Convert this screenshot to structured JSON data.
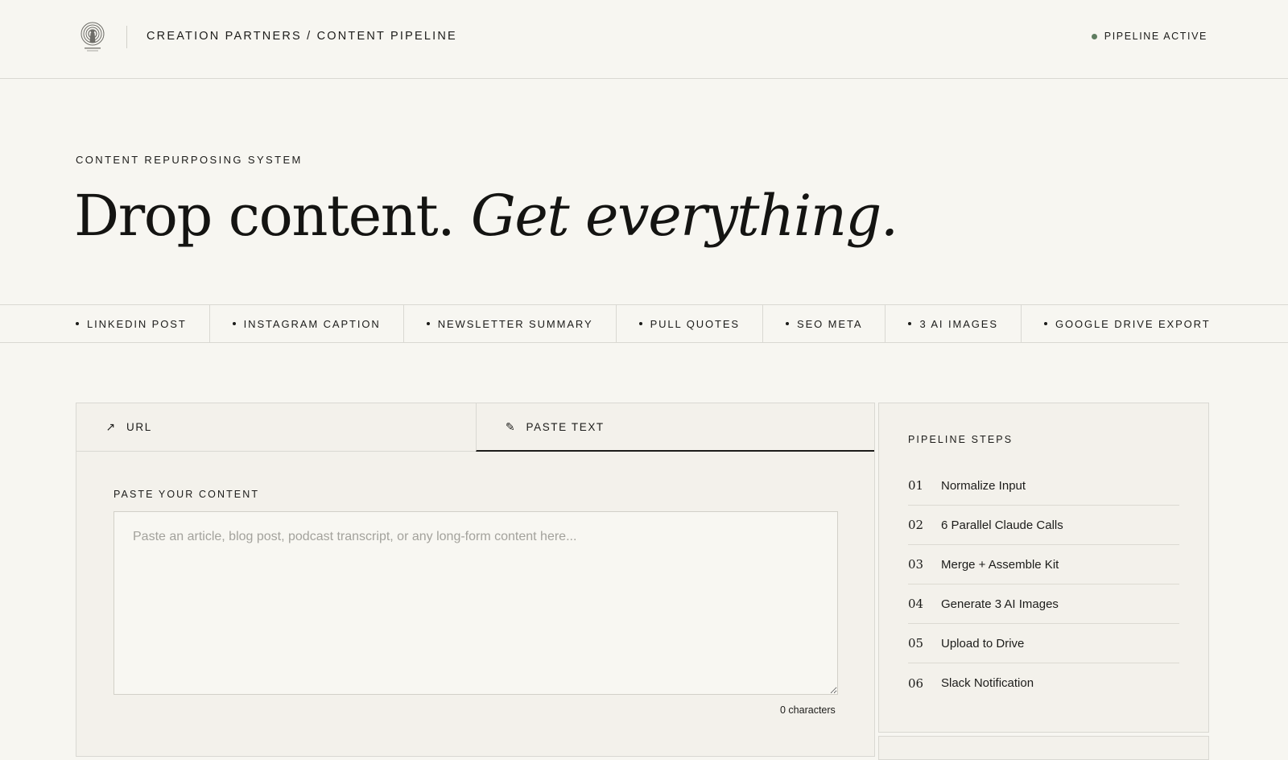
{
  "header": {
    "breadcrumb": "CREATION PARTNERS / CONTENT PIPELINE",
    "status": "PIPELINE ACTIVE",
    "status_color": "#5f7d60",
    "logo_icon": "creation-partners-logo"
  },
  "hero": {
    "eyebrow": "CONTENT REPURPOSING SYSTEM",
    "headline_plain": "Drop content.",
    "headline_italic": "Get everything."
  },
  "outputs": [
    "LINKEDIN POST",
    "INSTAGRAM CAPTION",
    "NEWSLETTER SUMMARY",
    "PULL QUOTES",
    "SEO META",
    "3 AI IMAGES",
    "GOOGLE DRIVE EXPORT"
  ],
  "input": {
    "tabs": [
      {
        "label": "URL",
        "icon": "arrow-up-right-icon",
        "glyph": "↗",
        "active": false
      },
      {
        "label": "PASTE TEXT",
        "icon": "pencil-icon",
        "glyph": "✎",
        "active": true
      }
    ],
    "field_label": "PASTE YOUR CONTENT",
    "placeholder": "Paste an article, blog post, podcast transcript, or any long-form content here...",
    "value": "",
    "char_count": "0 characters"
  },
  "pipeline": {
    "title": "PIPELINE STEPS",
    "steps": [
      {
        "num": "01",
        "label": "Normalize Input"
      },
      {
        "num": "02",
        "label": "6 Parallel Claude Calls"
      },
      {
        "num": "03",
        "label": "Merge + Assemble Kit"
      },
      {
        "num": "04",
        "label": "Generate 3 AI Images"
      },
      {
        "num": "05",
        "label": "Upload to Drive"
      },
      {
        "num": "06",
        "label": "Slack Notification"
      }
    ]
  }
}
